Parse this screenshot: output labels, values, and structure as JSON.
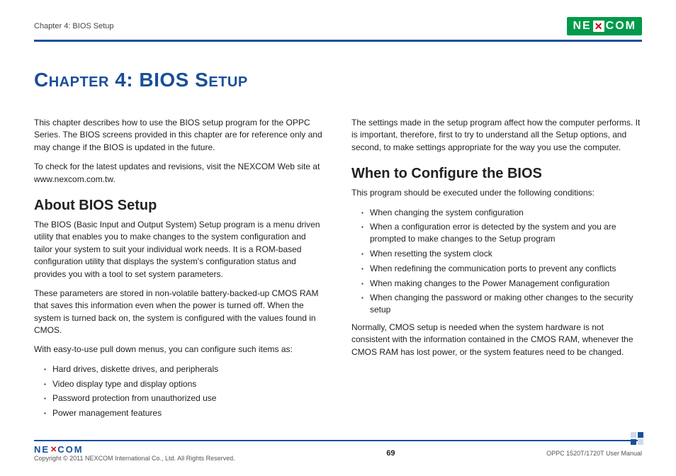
{
  "header": {
    "chapter_label": "Chapter 4: BIOS Setup",
    "logo": {
      "pre": "NE",
      "mid": "✕",
      "post": "COM"
    }
  },
  "title": "Chapter 4: BIOS Setup",
  "left": {
    "p1": "This chapter describes how to use the BIOS setup program for the OPPC Series. The BIOS screens provided in this chapter are for reference only and may change if the BIOS is updated in the future.",
    "p2": "To check for the latest updates and revisions, visit the NEXCOM Web site at www.nexcom.com.tw.",
    "h2": "About BIOS Setup",
    "p3": "The BIOS (Basic Input and Output System) Setup program is a menu driven utility that enables you to make changes to the system configuration and tailor your system to suit your individual work needs. It is a ROM-based configuration utility that displays the system's configuration status and provides you with a tool to set system parameters.",
    "p4": "These parameters are stored in non-volatile battery-backed-up CMOS RAM that saves this information even when the power is turned off. When the system is turned back on, the system is configured with the values found in CMOS.",
    "p5": "With easy-to-use pull down menus, you can configure such items as:",
    "bullets": [
      "Hard drives, diskette drives, and peripherals",
      "Video display type and display options",
      "Password protection from unauthorized use",
      "Power management features"
    ]
  },
  "right": {
    "p1": "The settings made in the setup program affect how the computer performs. It is important, therefore, first to try to understand all the Setup options, and second, to make settings appropriate for the way you use the computer.",
    "h2": "When to Configure the BIOS",
    "p2": "This program should be executed under the following conditions:",
    "bullets": [
      "When changing the system configuration",
      "When a configuration error is detected by the system and you are prompted to make changes to the Setup program",
      "When resetting the system clock",
      "When redefining the communication ports to prevent any conflicts",
      "When making changes to the Power Management configuration",
      "When changing the password or making other changes to the security setup"
    ],
    "p3": "Normally, CMOS setup is needed when the system hardware is not consistent with the information contained in the CMOS RAM, whenever the CMOS RAM has lost power, or the system features need to be changed."
  },
  "footer": {
    "logo": {
      "pre": "NE",
      "mid": "✕",
      "post": "COM"
    },
    "copyright": "Copyright © 2011 NEXCOM International Co., Ltd. All Rights Reserved.",
    "page": "69",
    "manual": "OPPC 1520T/1720T User Manual"
  }
}
